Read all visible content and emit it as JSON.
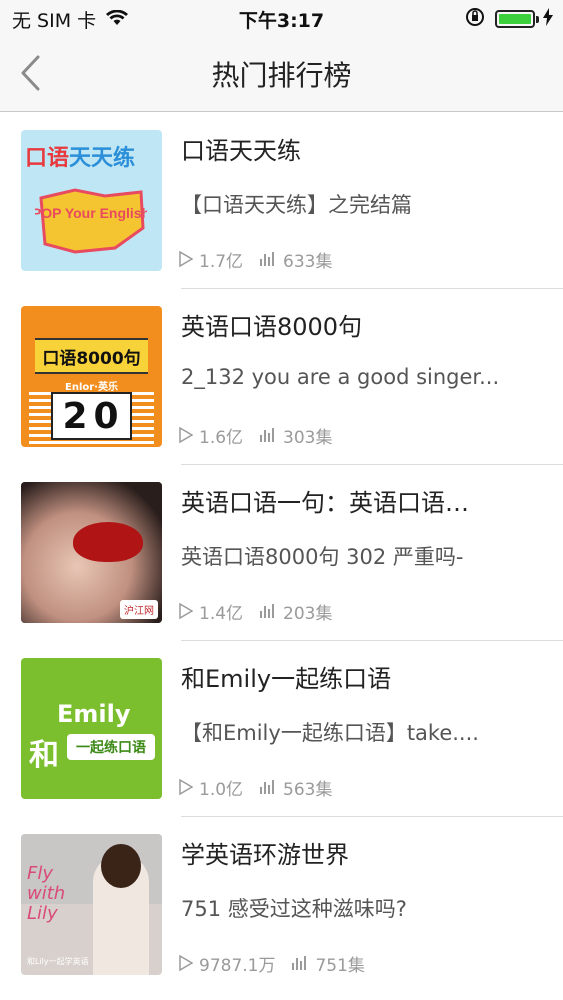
{
  "status_bar": {
    "carrier": "无 SIM 卡",
    "time": "下午3:17",
    "wifi_icon": "wifi-icon",
    "lock_icon": "rotation-lock-icon",
    "battery_icon": "battery-icon",
    "charging_icon": "charging-bolt-icon",
    "battery_color": "#3cd13c"
  },
  "nav": {
    "title": "热门排行榜",
    "back_icon": "chevron-left-icon"
  },
  "items": [
    {
      "title": "口语天天练",
      "subtitle": "【口语天天练】之完结篇",
      "plays": "1.7亿",
      "episodes": "633集",
      "cover_text": {
        "cn_a": "口语",
        "cn_b": "天天练",
        "en": "POP Your English"
      }
    },
    {
      "title": "英语口语8000句",
      "subtitle": "2_132 you are a good singer...",
      "plays": "1.6亿",
      "episodes": "303集",
      "cover_text": {
        "band": "口语8000句",
        "small": "Enlor·英乐",
        "number": "20"
      }
    },
    {
      "title": "英语口语一句：英语口语…",
      "subtitle": "英语口语8000句 302 严重吗-",
      "plays": "1.4亿",
      "episodes": "203集",
      "cover_text": {
        "logo": "沪江网"
      }
    },
    {
      "title": "和Emily一起练口语",
      "subtitle": "【和Emily一起练口语】take....",
      "plays": "1.0亿",
      "episodes": "563集",
      "cover_text": {
        "emily": "Emily",
        "he": "和",
        "tag": "一起练口语"
      }
    },
    {
      "title": "学英语环游世界",
      "subtitle": "751 感受过这种滋味吗?",
      "plays": "9787.1万",
      "episodes": "751集",
      "cover_text": {
        "fly": "Fly with Lily",
        "caption": "和Lily一起学英语"
      }
    }
  ],
  "meta_icons": {
    "plays": "play-triangle-icon",
    "episodes": "bar-chart-icon"
  },
  "colors": {
    "nav_bg": "#f7f7f7",
    "meta_gray": "#9a9a9a"
  }
}
